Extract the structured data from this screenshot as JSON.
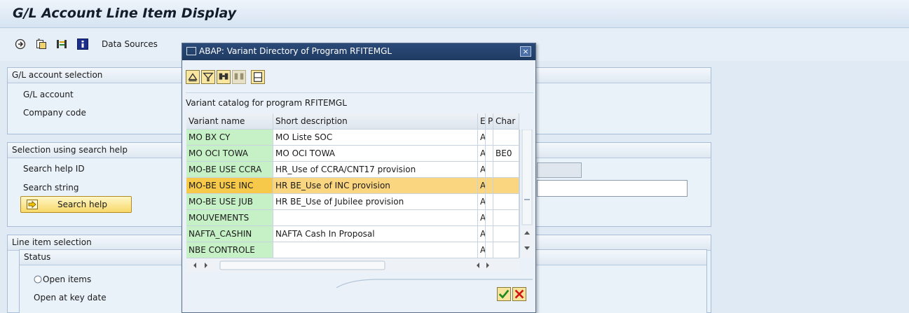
{
  "window": {
    "title": "G/L Account Line Item Display"
  },
  "toolbar": {
    "icons": [
      "execute-icon",
      "get-variant-icon",
      "dynamic-selections-icon",
      "info-icon"
    ],
    "data_sources_label": "Data Sources"
  },
  "gl_selection": {
    "header": "G/L account selection",
    "gl_account_label": "G/L account",
    "company_code_label": "Company code"
  },
  "search_selection": {
    "header": "Selection using search help",
    "search_help_id_label": "Search help ID",
    "search_string_label": "Search string",
    "search_help_button": "Search help"
  },
  "line_item_selection": {
    "header": "Line item selection",
    "status_header": "Status",
    "open_items_label": "Open items",
    "open_at_key_date_label": "Open at key date"
  },
  "dialog": {
    "title": "ABAP: Variant Directory of Program RFITEMGL",
    "close_label": "×",
    "catalog_text": "Variant catalog for program RFITEMGL",
    "columns": [
      "Variant name",
      "Short description",
      "E",
      "P",
      "Char"
    ],
    "rows": [
      {
        "name": "MO BX CY",
        "desc": "MO Liste SOC",
        "e": "A",
        "p": "",
        "char": ""
      },
      {
        "name": "MO OCI TOWA",
        "desc": "MO OCI TOWA",
        "e": "A",
        "p": "",
        "char": "BE0"
      },
      {
        "name": "MO-BE USE CCRA",
        "desc": "HR_Use of CCRA/CNT17 provision",
        "e": "A",
        "p": "",
        "char": ""
      },
      {
        "name": "MO-BE USE INC",
        "desc": "HR BE_Use of INC provision",
        "e": "A",
        "p": "",
        "char": ""
      },
      {
        "name": "MO-BE USE JUB",
        "desc": "HR BE_Use of Jubilee provision",
        "e": "A",
        "p": "",
        "char": ""
      },
      {
        "name": "MOUVEMENTS",
        "desc": "",
        "e": "A",
        "p": "",
        "char": ""
      },
      {
        "name": "NAFTA_CASHIN",
        "desc": "NAFTA Cash In Proposal",
        "e": "A",
        "p": "",
        "char": ""
      },
      {
        "name": "NBE CONTROLE",
        "desc": "",
        "e": "A",
        "p": "",
        "char": ""
      }
    ],
    "selected_row": 3
  }
}
